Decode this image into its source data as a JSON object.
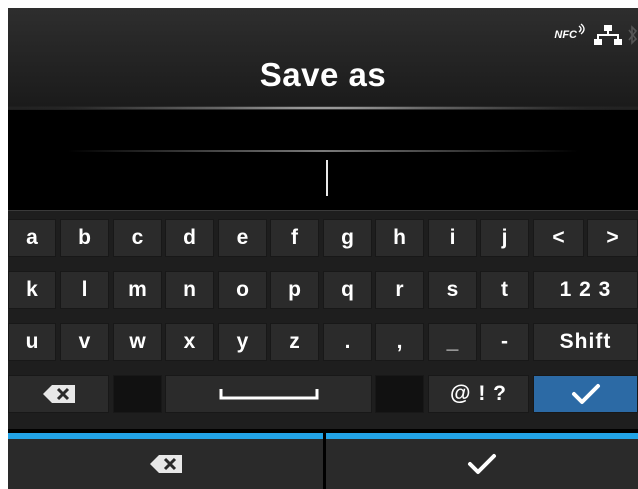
{
  "header": {
    "title": "Save as",
    "status": {
      "nfc_label": "NFC",
      "nfc_icon": "nfc-wave-icon",
      "network_icon": "network-icon",
      "bluetooth_icon": "bluetooth-icon"
    }
  },
  "input": {
    "value": ""
  },
  "keyboard": {
    "row1": [
      "a",
      "b",
      "c",
      "d",
      "e",
      "f",
      "g",
      "h",
      "i",
      "j"
    ],
    "row2": [
      "k",
      "l",
      "m",
      "n",
      "o",
      "p",
      "q",
      "r",
      "s",
      "t"
    ],
    "row3": [
      "u",
      "v",
      "w",
      "x",
      "y",
      "z",
      ".",
      ",",
      "_",
      "-"
    ],
    "left_arrow": "<",
    "right_arrow": ">",
    "numbers_label": "1 2 3",
    "shift_label": "Shift",
    "symbols_label": "@ ! ?",
    "backspace_icon": "backspace-icon",
    "space_icon": "space-icon",
    "enter_icon": "checkmark-icon"
  },
  "footer": {
    "delete_icon": "backspace-icon",
    "confirm_icon": "checkmark-icon",
    "accent_color": "#22a3e6"
  },
  "colors": {
    "enter_key": "#2c6aa5"
  }
}
